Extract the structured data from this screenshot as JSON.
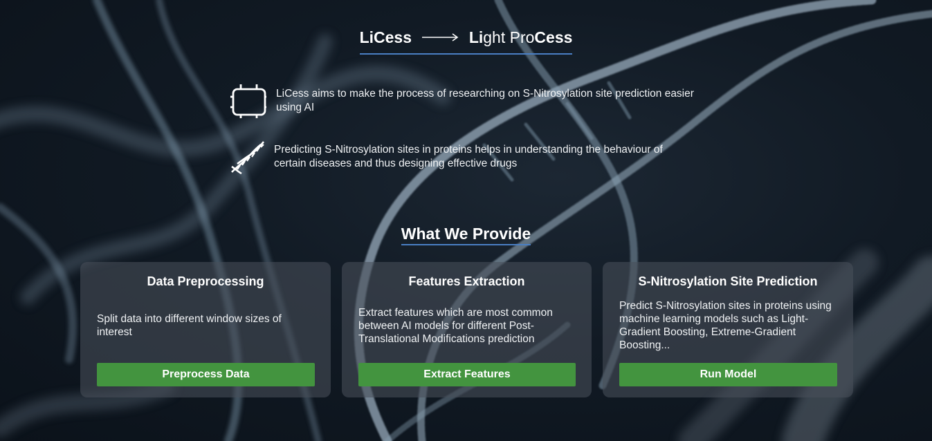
{
  "hero": {
    "title_left": "LiCess",
    "title_right_bold1": "Li",
    "title_right_light1": "ght Pro",
    "title_right_bold2": "Cess"
  },
  "features": [
    {
      "icon": "chip-icon",
      "text": "LiCess aims to make the process of researching on S-Nitrosylation site prediction easier using AI"
    },
    {
      "icon": "dna-icon",
      "text": "Predicting S-Nitrosylation sites in proteins helps in understanding the behaviour of certain diseases and thus designing effective drugs"
    }
  ],
  "section": {
    "title": "What We Provide"
  },
  "cards": [
    {
      "title": "Data Preprocessing",
      "description": "Split data into different window sizes of interest",
      "button": "Preprocess Data"
    },
    {
      "title": "Features Extraction",
      "description": "Extract features which are most common between AI models for different Post-Translational Modifications prediction",
      "button": "Extract Features"
    },
    {
      "title": "S-Nitrosylation Site Prediction",
      "description": "Predict S-Nitrosylation sites in proteins using machine learning models such as Light-Gradient Boosting, Extreme-Gradient Boosting...",
      "button": "Run Model"
    }
  ],
  "colors": {
    "accent_underline": "#4a7fc4",
    "button_green": "#43943f",
    "background": "#111a24"
  }
}
